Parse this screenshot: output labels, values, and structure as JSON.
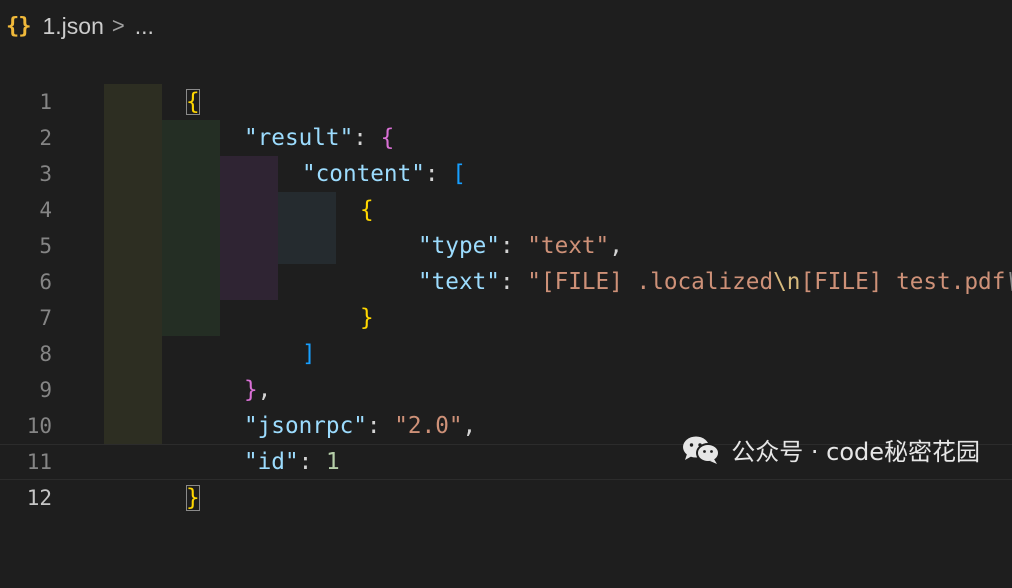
{
  "breadcrumb": {
    "file_icon": "{}",
    "file_name": "1.json",
    "separator": ">",
    "more": "..."
  },
  "editor": {
    "line_numbers": [
      "1",
      "2",
      "3",
      "4",
      "5",
      "6",
      "7",
      "8",
      "9",
      "10",
      "11",
      "12"
    ],
    "active_line": "12",
    "lines": {
      "l1": {
        "open": "{"
      },
      "l2": {
        "key": "\"result\"",
        "colon": ": ",
        "open": "{"
      },
      "l3": {
        "key": "\"content\"",
        "colon": ": ",
        "open": "["
      },
      "l4": {
        "open": "{"
      },
      "l5": {
        "key": "\"type\"",
        "colon": ": ",
        "value": "\"text\"",
        "comma": ","
      },
      "l6": {
        "key": "\"text\"",
        "colon": ": ",
        "value_a": "\"[FILE] .localized",
        "esc1": "\\n",
        "value_b": "[FILE] test.pdf",
        "esc2": "\\n"
      },
      "l7": {
        "close": "}"
      },
      "l8": {
        "close": "]"
      },
      "l9": {
        "close": "}",
        "comma": ","
      },
      "l10": {
        "key": "\"jsonrpc\"",
        "colon": ": ",
        "value": "\"2.0\"",
        "comma": ","
      },
      "l11": {
        "key": "\"id\"",
        "colon": ": ",
        "value": "1"
      },
      "l12": {
        "close": "}"
      }
    }
  },
  "watermark": {
    "text": "公众号 · code秘密花园",
    "icon": "wechat-icon"
  },
  "colors": {
    "background": "#1e1e1e",
    "key": "#9cdcfe",
    "string": "#ce9178",
    "number": "#b5cea8",
    "bracket_level_1": "#ffd700",
    "bracket_level_2": "#da70d6",
    "bracket_level_3": "#179fff",
    "escape": "#d7ba7d"
  }
}
